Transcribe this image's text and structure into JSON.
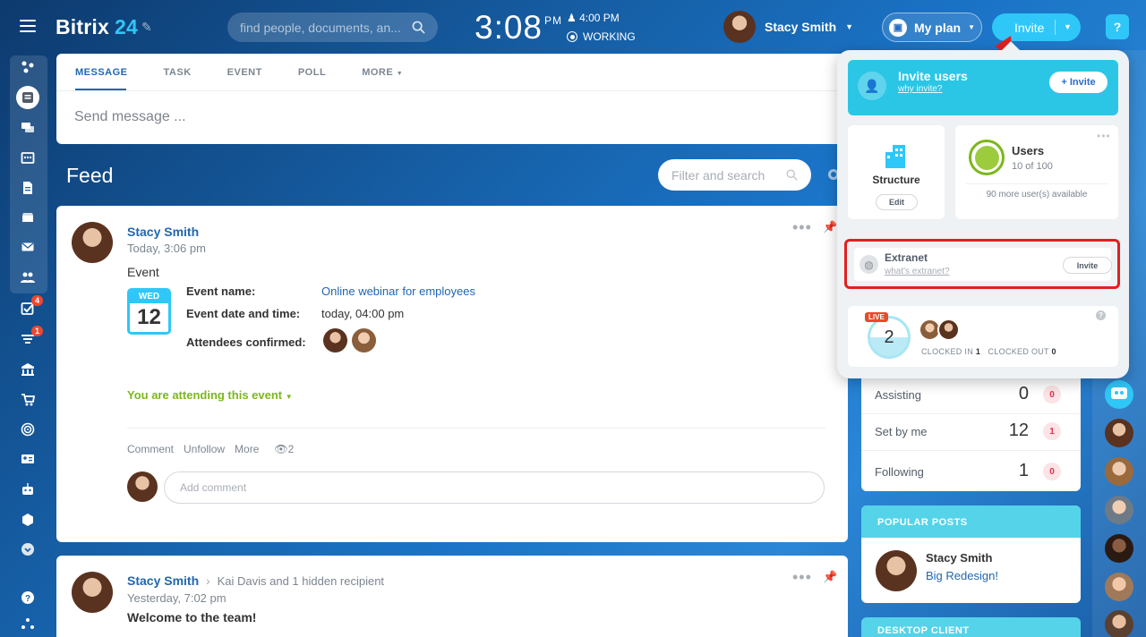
{
  "header": {
    "logo_text": "Bitrix",
    "logo_num": "24",
    "search_placeholder": "find people, documents, an...",
    "time": "3:08",
    "ampm": "PM",
    "alarm_time": "4:00 PM",
    "work_status": "WORKING",
    "user_name": "Stacy Smith",
    "my_plan": "My plan",
    "invite": "Invite",
    "help": "?"
  },
  "sidebar": {
    "badges": {
      "tasks": "4",
      "filter": "1"
    }
  },
  "composer": {
    "tabs": [
      "MESSAGE",
      "TASK",
      "EVENT",
      "POLL",
      "MORE"
    ],
    "placeholder": "Send message ..."
  },
  "feed": {
    "title": "Feed",
    "filter_placeholder": "Filter and search"
  },
  "post1": {
    "author": "Stacy Smith",
    "time": "Today, 3:06 pm",
    "type": "Event",
    "cal_day_name": "WED",
    "cal_day": "12",
    "labels": {
      "event_name": "Event name:",
      "event_date": "Event date and time:",
      "attendees": "Attendees confirmed:"
    },
    "event_name": "Online webinar for employees",
    "event_date": "today, 04:00 pm",
    "attending": "You are attending this event",
    "actions": {
      "comment": "Comment",
      "unfollow": "Unfollow",
      "more": "More",
      "views": "2"
    },
    "add_comment": "Add comment"
  },
  "post2": {
    "author": "Stacy Smith",
    "recipients": "Kai Davis and 1 hidden recipient",
    "time": "Yesterday, 7:02 pm",
    "title": "Welcome to the team!"
  },
  "popup": {
    "invite_title": "Invite users",
    "invite_sub": "why invite?",
    "invite_btn": "+ Invite",
    "structure": "Structure",
    "edit": "Edit",
    "users_title": "Users",
    "users_count": "10 of 100",
    "users_more": "90 more user(s) available",
    "extranet": "Extranet",
    "extranet_sub": "what's extranet?",
    "extranet_btn": "Invite",
    "live": "LIVE",
    "clocked_count": "2",
    "clocked_in_label": "CLOCKED IN",
    "clocked_in": "1",
    "clocked_out_label": "CLOCKED OUT",
    "clocked_out": "0"
  },
  "tasks": [
    {
      "label": "Assisting",
      "count": "0",
      "badge": "0"
    },
    {
      "label": "Set by me",
      "count": "12",
      "badge": "1"
    },
    {
      "label": "Following",
      "count": "1",
      "badge": "0"
    }
  ],
  "popular": {
    "title": "POPULAR POSTS",
    "author": "Stacy Smith",
    "post": "Big Redesign!"
  },
  "desktop_client": "DESKTOP CLIENT",
  "colors": {
    "accent": "#2fc7f7",
    "link": "#2067b0",
    "green": "#7cb71b",
    "highlight": "#e02020"
  }
}
